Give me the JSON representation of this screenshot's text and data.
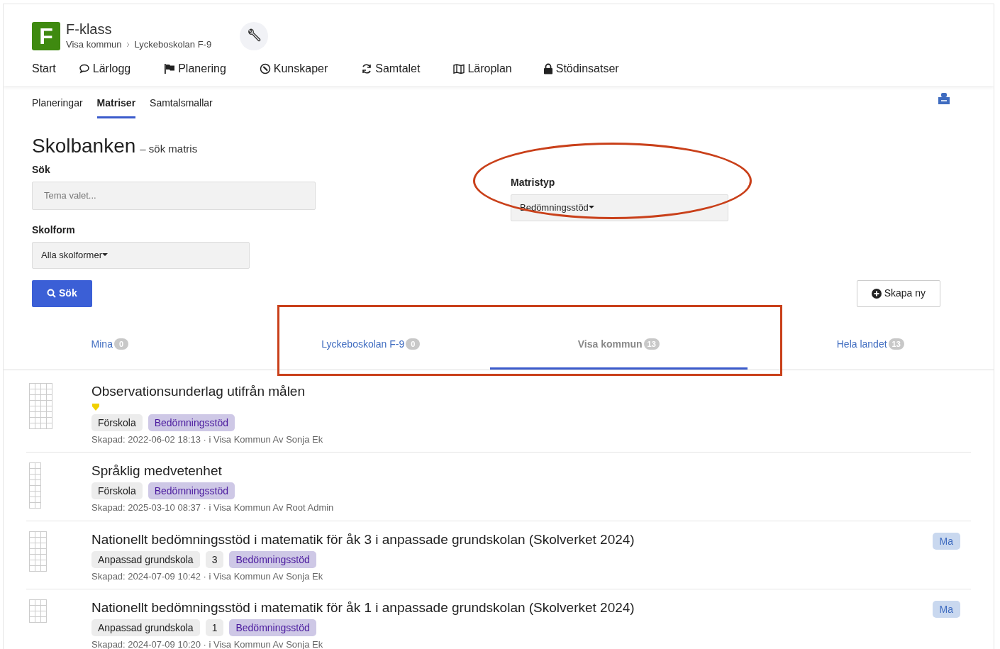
{
  "app": {
    "logo_letter": "F",
    "title": "F-klass",
    "breadcrumb": [
      "Visa kommun",
      "Lyckeboskolan F-9"
    ]
  },
  "nav": [
    {
      "label": "Start"
    },
    {
      "label": "Lärlogg"
    },
    {
      "label": "Planering"
    },
    {
      "label": "Kunskaper"
    },
    {
      "label": "Samtalet"
    },
    {
      "label": "Läroplan"
    },
    {
      "label": "Stödinsatser"
    }
  ],
  "subnav": [
    {
      "label": "Planeringar",
      "selected": false
    },
    {
      "label": "Matriser",
      "selected": true
    },
    {
      "label": "Samtalsmallar",
      "selected": false
    }
  ],
  "heading": {
    "title": "Skolbanken",
    "subtitle": "– sök matris"
  },
  "search": {
    "label": "Sök",
    "placeholder": "Tema valet..."
  },
  "matristyp": {
    "label": "Matristyp",
    "value": "Bedömningsstöd"
  },
  "skolform": {
    "label": "Skolform",
    "value": "Alla skolformer"
  },
  "search_button": "Sök",
  "create_button": "Skapa ny",
  "tabs": [
    {
      "label": "Mina",
      "count": "0",
      "selected": false
    },
    {
      "label": "Lyckeboskolan F-9",
      "count": "0",
      "selected": false
    },
    {
      "label": "Visa kommun",
      "count": "13",
      "selected": true
    },
    {
      "label": "Hela landet",
      "count": "13",
      "selected": false
    }
  ],
  "results": [
    {
      "title": "Observationsunderlag utifrån målen",
      "marked": true,
      "tags": [
        {
          "kind": "school",
          "text": "Förskola"
        },
        {
          "kind": "type",
          "text": "Bedömningsstöd"
        }
      ],
      "meta": "Skapad: 2022-06-02 18:13 · i Visa Kommun Av Sonja Ek"
    },
    {
      "title": "Språklig medvetenhet",
      "marked": false,
      "tags": [
        {
          "kind": "school",
          "text": "Förskola"
        },
        {
          "kind": "type",
          "text": "Bedömningsstöd"
        }
      ],
      "meta": "Skapad: 2025-03-10 08:37 · i Visa Kommun Av Root Admin"
    },
    {
      "title": "Nationellt bedömningsstöd i matematik för åk 3 i anpassade grundskolan (Skolverket 2024)",
      "marked": false,
      "subject": "Ma",
      "tags": [
        {
          "kind": "school",
          "text": "Anpassad grundskola"
        },
        {
          "kind": "grade",
          "text": "3"
        },
        {
          "kind": "type",
          "text": "Bedömningsstöd"
        }
      ],
      "meta": "Skapad: 2024-07-09 10:42 · i Visa Kommun Av Sonja Ek"
    },
    {
      "title": "Nationellt bedömningsstöd i matematik för åk 1 i anpassade grundskolan (Skolverket 2024)",
      "marked": false,
      "subject": "Ma",
      "tags": [
        {
          "kind": "school",
          "text": "Anpassad grundskola"
        },
        {
          "kind": "grade",
          "text": "1"
        },
        {
          "kind": "type",
          "text": "Bedömningsstöd"
        }
      ],
      "meta": "Skapad: 2024-07-09 10:20 · i Visa Kommun Av Sonja Ek"
    }
  ]
}
